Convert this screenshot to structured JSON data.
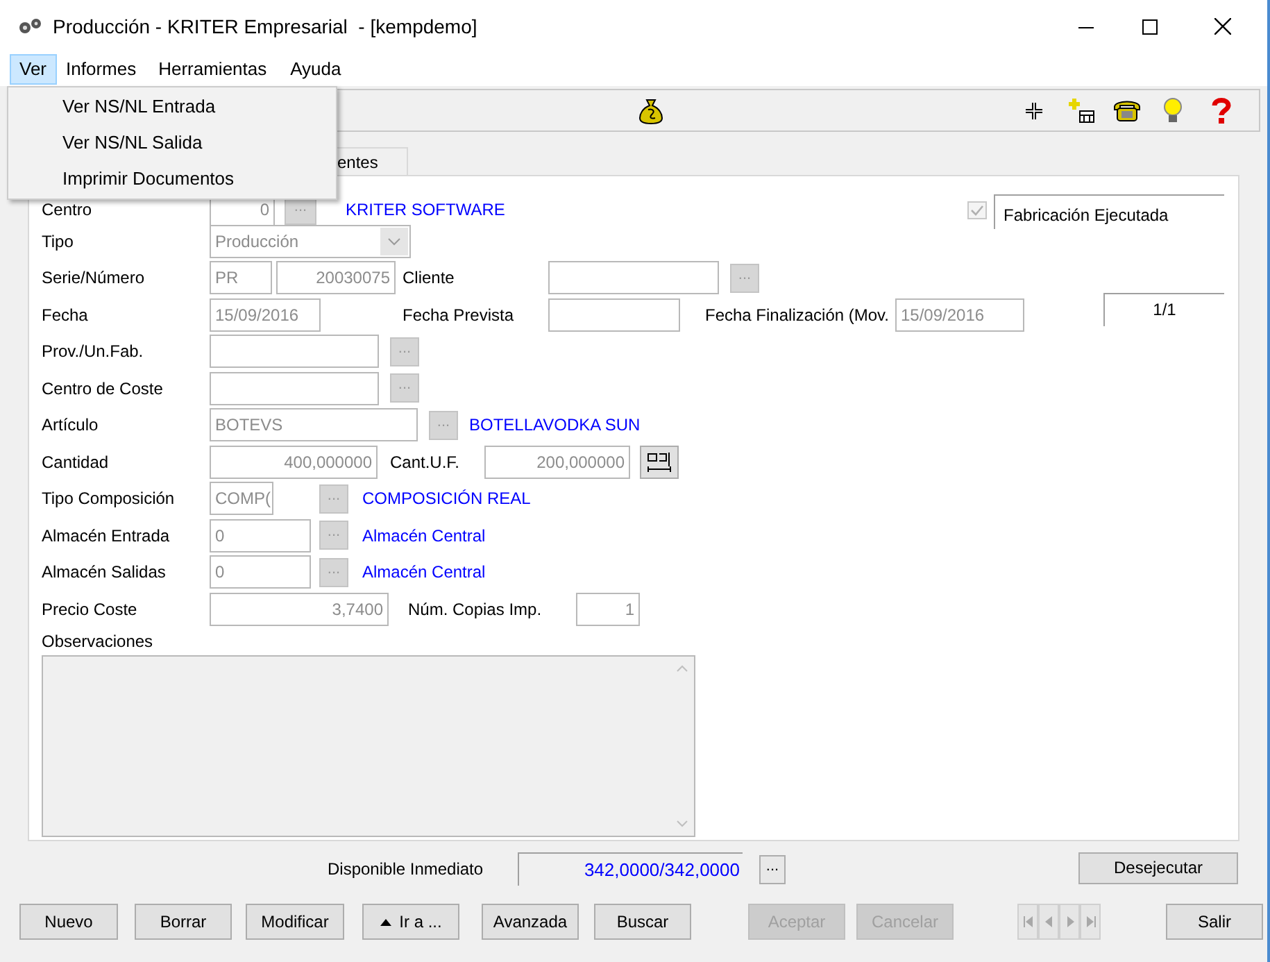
{
  "window": {
    "title": "Producción - KRITER Empresarial  - [kempdemo]"
  },
  "menu_bar": [
    {
      "label": "Ver",
      "selected": true
    },
    {
      "label": "Informes",
      "selected": false
    },
    {
      "label": "Herramientas",
      "selected": false
    },
    {
      "label": "Ayuda",
      "selected": false
    }
  ],
  "open_menu": {
    "items": [
      "Ver NS/NL Entrada",
      "Ver NS/NL Salida",
      "Imprimir Documentos"
    ]
  },
  "tabs": [
    {
      "label": "entes",
      "selected": false
    }
  ],
  "form": {
    "rows": [
      {
        "label": "Centro",
        "parts": [
          {
            "kind": "field",
            "value": "0",
            "disabled": true
          },
          {
            "kind": "lookup",
            "label": "...",
            "disabled": true
          },
          {
            "kind": "link",
            "text": "KRITER SOFTWARE"
          },
          {
            "kind": "checkbox",
            "checked": true,
            "disabled": true
          },
          {
            "kind": "caption",
            "text": "Fabricación Ejecutada"
          }
        ]
      },
      {
        "label": "Tipo",
        "parts": [
          {
            "kind": "select",
            "value": "Producción",
            "disabled": true
          }
        ]
      },
      {
        "label": "Serie/Número",
        "parts": [
          {
            "kind": "field",
            "value": "PR",
            "disabled": true
          },
          {
            "kind": "field",
            "value": "20030075",
            "disabled": true
          },
          {
            "kind": "text",
            "text": "Cliente"
          },
          {
            "kind": "field"
          },
          {
            "kind": "lookup",
            "label": "...",
            "disabled": true
          }
        ]
      },
      {
        "label": "Fecha",
        "parts": [
          {
            "kind": "field",
            "value": "15/09/2016",
            "disabled": true
          },
          {
            "kind": "text",
            "text": "Fecha Prevista"
          },
          {
            "kind": "field"
          },
          {
            "kind": "text",
            "text": "Fecha Finalización (Mov."
          },
          {
            "kind": "field",
            "value": "15/09/2016",
            "disabled": true
          },
          {
            "kind": "counter",
            "text": "1/1"
          }
        ]
      },
      {
        "label": "Prov./Un.Fab.",
        "parts": [
          {
            "kind": "field"
          },
          {
            "kind": "lookup",
            "label": "...",
            "disabled": true
          }
        ]
      },
      {
        "label": "Centro de Coste",
        "parts": [
          {
            "kind": "field"
          },
          {
            "kind": "lookup",
            "label": "...",
            "disabled": true
          }
        ]
      },
      {
        "label": "Artículo",
        "parts": [
          {
            "kind": "field",
            "value": "BOTEVS",
            "disabled": true
          },
          {
            "kind": "lookup",
            "label": "...",
            "disabled": true
          },
          {
            "kind": "link",
            "text": "BOTELLAVODKA SUN"
          }
        ]
      },
      {
        "label": "Cantidad",
        "parts": [
          {
            "kind": "field",
            "value": "400,000000",
            "disabled": true
          },
          {
            "kind": "text",
            "text": "Cant.U.F."
          },
          {
            "kind": "field",
            "value": "200,000000",
            "disabled": true
          },
          {
            "kind": "tool"
          }
        ]
      },
      {
        "label": "Tipo Composición",
        "parts": [
          {
            "kind": "field",
            "value": "COMP(",
            "disabled": true
          },
          {
            "kind": "lookup",
            "label": "...",
            "disabled": true
          },
          {
            "kind": "link",
            "text": "COMPOSICIÓN REAL"
          }
        ]
      },
      {
        "label": "Almacén Entrada",
        "parts": [
          {
            "kind": "field",
            "value": "0",
            "disabled": true
          },
          {
            "kind": "lookup",
            "label": "...",
            "disabled": true
          },
          {
            "kind": "link",
            "text": "Almacén Central"
          }
        ]
      },
      {
        "label": "Almacén Salidas",
        "parts": [
          {
            "kind": "field",
            "value": "0",
            "disabled": true
          },
          {
            "kind": "lookup",
            "label": "...",
            "disabled": true
          },
          {
            "kind": "link",
            "text": "Almacén Central"
          }
        ]
      },
      {
        "label": "Precio Coste",
        "parts": [
          {
            "kind": "field",
            "value": "3,7400",
            "disabled": true
          },
          {
            "kind": "text",
            "text": "Núm. Copias Imp."
          },
          {
            "kind": "field",
            "value": "1",
            "disabled": true
          }
        ]
      }
    ],
    "observations": {
      "label": "Observaciones"
    }
  },
  "footer": {
    "label": "Disponible Inmediato",
    "value": "342,0000/342,0000",
    "lookup": {
      "label": "...",
      "disabled": false
    },
    "action": {
      "label": "Desejecutar"
    }
  },
  "buttons": [
    {
      "label": "Nuevo",
      "disabled": false
    },
    {
      "label": "Borrar",
      "disabled": false
    },
    {
      "label": "Modificar",
      "disabled": false
    },
    {
      "label": "Ir a ...",
      "kind": "goto",
      "disabled": false
    },
    {
      "label": "Avanzada",
      "disabled": false
    },
    {
      "label": "Buscar",
      "disabled": false
    },
    {
      "label": "Aceptar",
      "disabled": true
    },
    {
      "label": "Cancelar",
      "disabled": true
    },
    {
      "label": "Salir",
      "disabled": false
    }
  ],
  "nav_buttons": [
    {
      "kind": "first",
      "disabled": true
    },
    {
      "kind": "prev",
      "disabled": true
    },
    {
      "kind": "next",
      "disabled": true
    },
    {
      "kind": "last",
      "disabled": true
    }
  ]
}
